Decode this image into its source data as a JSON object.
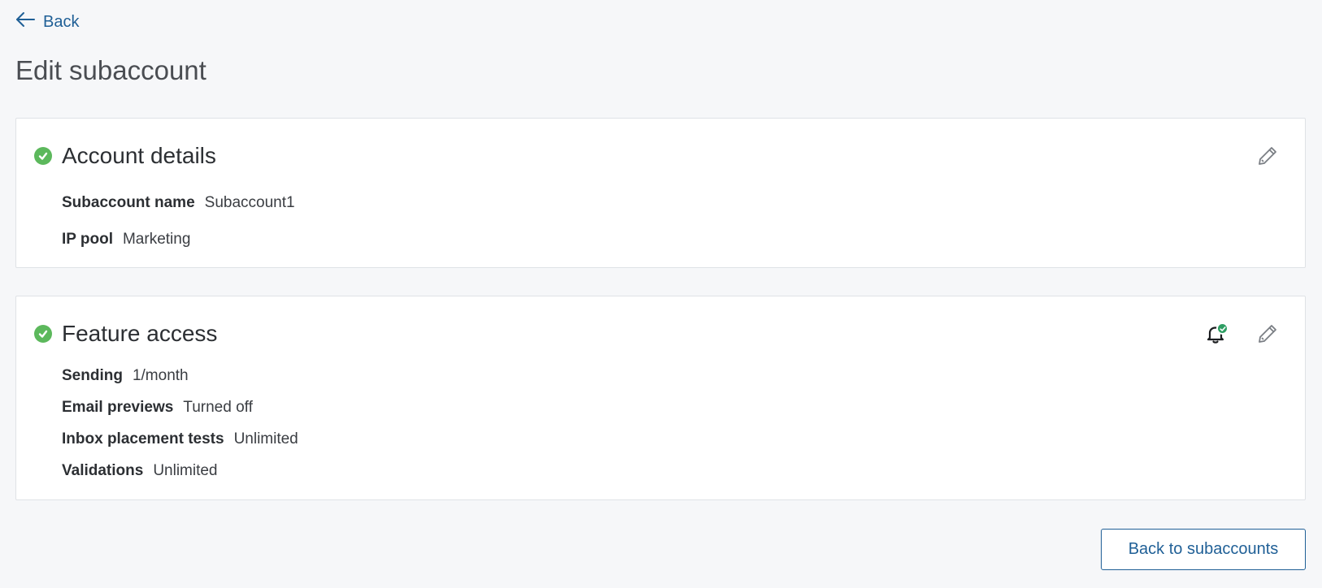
{
  "nav": {
    "back_label": "Back"
  },
  "page": {
    "title": "Edit subaccount"
  },
  "account_details": {
    "title": "Account details",
    "rows": [
      {
        "label": "Subaccount name",
        "value": "Subaccount1"
      },
      {
        "label": "IP pool",
        "value": "Marketing"
      }
    ]
  },
  "feature_access": {
    "title": "Feature access",
    "rows": [
      {
        "label": "Sending",
        "value": "1/month"
      },
      {
        "label": "Email previews",
        "value": "Turned off"
      },
      {
        "label": "Inbox placement tests",
        "value": "Unlimited"
      },
      {
        "label": "Validations",
        "value": "Unlimited"
      }
    ]
  },
  "footer": {
    "back_to_subaccounts_label": "Back to subaccounts"
  },
  "icons": {
    "back": "arrow-left-icon",
    "status": "check-circle-icon",
    "edit": "pencil-icon",
    "notification": "bell-icon"
  },
  "colors": {
    "accent": "#1f5f96",
    "success": "#5cb85c",
    "badge": "#2e9e63",
    "background": "#f6f7f9"
  }
}
